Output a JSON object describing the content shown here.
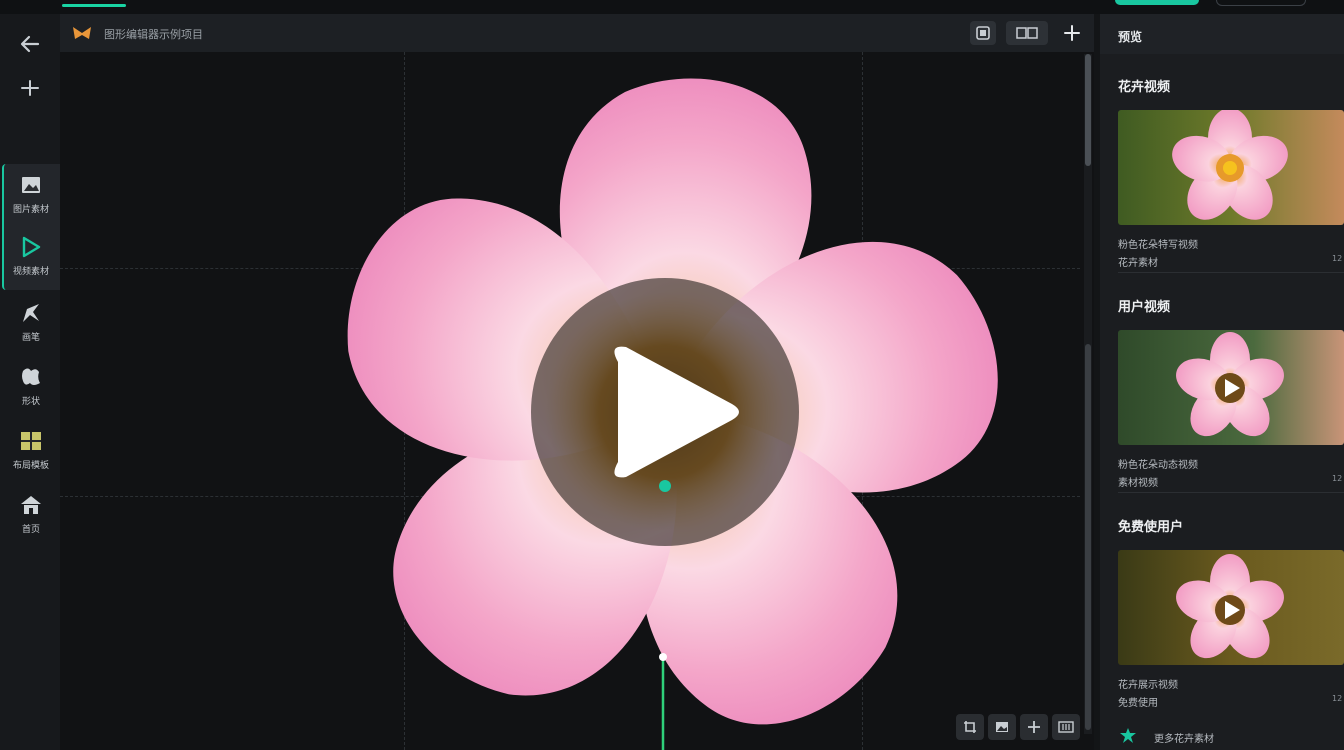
{
  "app": {
    "document_title": "图形编辑器示例项目",
    "accent_color": "#19c7a0",
    "background_color": "#131517"
  },
  "left_rail": {
    "nav": [
      {
        "icon": "arrow-left-icon"
      },
      {
        "icon": "plus-icon"
      }
    ],
    "tools": [
      {
        "icon": "image-icon",
        "label": "图片素材"
      },
      {
        "icon": "play-icon",
        "label": "视频素材"
      },
      {
        "icon": "pen-icon",
        "label": "画笔"
      },
      {
        "icon": "shape-icon",
        "label": "形状"
      },
      {
        "icon": "layout-icon",
        "label": "布局模板"
      },
      {
        "icon": "home-icon",
        "label": "首页"
      }
    ]
  },
  "doc_bar": {
    "buttons": [
      {
        "icon": "frame-icon"
      },
      {
        "icon": "grid-icon"
      },
      {
        "icon": "plus-icon"
      }
    ]
  },
  "canvas": {
    "subject": "pink-flower-video",
    "play_overlay_icon": "play-icon",
    "bottom_tools": [
      {
        "icon": "crop-icon"
      },
      {
        "icon": "image-icon"
      },
      {
        "icon": "plus-icon"
      },
      {
        "icon": "settings-icon"
      }
    ]
  },
  "right_panel": {
    "header": "预览",
    "sections": [
      {
        "title": "花卉视频",
        "line1": "粉色花朵特写视频",
        "line2": "花卉素材",
        "badge": "12",
        "has_play": false
      },
      {
        "title": "用户视频",
        "line1": "粉色花朵动态视频",
        "line2": "素材视频",
        "badge": "12",
        "has_play": true
      },
      {
        "title": "免费使用户",
        "line1": "花卉展示视频",
        "line2": "免费使用",
        "badge": "12",
        "has_play": true
      }
    ],
    "footer_label": "更多花卉素材",
    "footer_icon": "flower-icon"
  }
}
